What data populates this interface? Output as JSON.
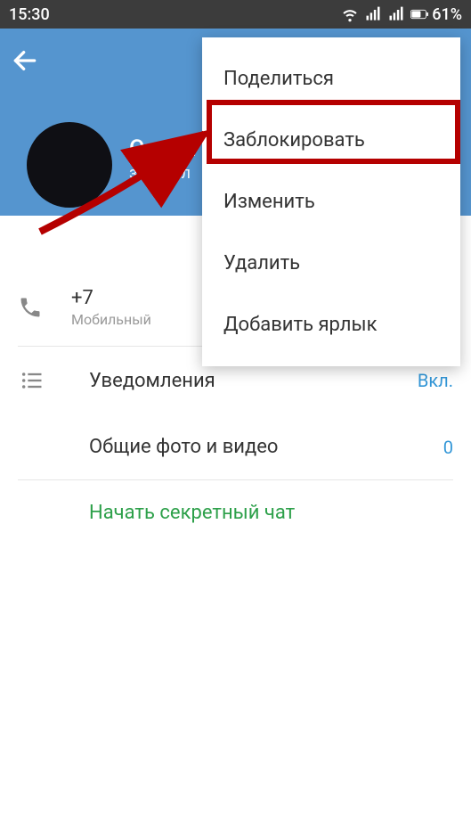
{
  "status": {
    "time": "15:30",
    "battery_pct": "61%"
  },
  "header": {
    "name": "Скрип",
    "subtitle": "заходил"
  },
  "menu": {
    "share": "Поделиться",
    "block": "Заблокировать",
    "edit": "Изменить",
    "delete": "Удалить",
    "add_shortcut": "Добавить ярлык"
  },
  "phone": {
    "number": "+7",
    "type": "Мобильный"
  },
  "rows": {
    "notifications_label": "Уведомления",
    "notifications_value": "Вкл.",
    "media_label": "Общие фото и видео",
    "media_count": "0",
    "secret_chat": "Начать секретный чат"
  }
}
